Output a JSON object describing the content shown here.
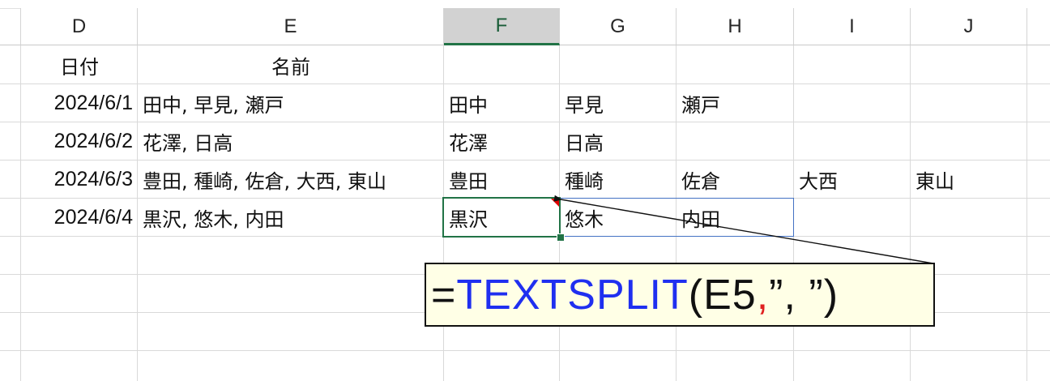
{
  "columns": [
    {
      "id": "D",
      "label": "D"
    },
    {
      "id": "E",
      "label": "E"
    },
    {
      "id": "F",
      "label": "F"
    },
    {
      "id": "G",
      "label": "G"
    },
    {
      "id": "H",
      "label": "H"
    },
    {
      "id": "I",
      "label": "I"
    },
    {
      "id": "J",
      "label": "J"
    }
  ],
  "selected_column": "F",
  "header_row": {
    "date": "日付",
    "name": "名前"
  },
  "rows": [
    {
      "date": "2024/6/1",
      "names": "田中, 早見, 瀬戸",
      "split": [
        "田中",
        "早見",
        "瀬戸"
      ]
    },
    {
      "date": "2024/6/2",
      "names": "花澤, 日高",
      "split": [
        "花澤",
        "日高"
      ]
    },
    {
      "date": "2024/6/3",
      "names": "豊田, 種崎, 佐倉, 大西, 東山",
      "split": [
        "豊田",
        "種崎",
        "佐倉",
        "大西",
        "東山"
      ]
    },
    {
      "date": "2024/6/4",
      "names": "黒沢, 悠木, 内田",
      "split": [
        "黒沢",
        "悠木",
        "内田"
      ]
    }
  ],
  "formula": {
    "equals": "=",
    "function": "TEXTSPLIT",
    "open": "(",
    "ref": "E5",
    "comma": ",",
    "delimiter": "”, ”",
    "close": ")"
  },
  "colors": {
    "grid": "#d9d9d9",
    "selection": "#217346",
    "spill_border": "#4472c4",
    "callout_bg": "#ffffe6",
    "function_color": "#1f2ff0",
    "separator_color": "#e02020",
    "comment_flag": "#e00000"
  }
}
